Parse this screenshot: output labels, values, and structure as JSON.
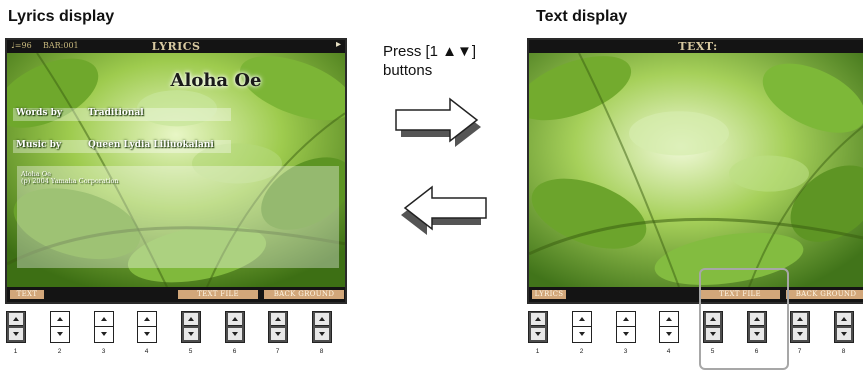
{
  "left_panel": {
    "heading": "Lyrics display",
    "screen": {
      "tempo": "♩=96",
      "bar": "BAR:001",
      "title": "LYRICS",
      "arrow_glyph": "▸",
      "song_title": "Aloha Oe",
      "words_label": "Words by",
      "words_value": "Traditional",
      "music_label": "Music by",
      "music_value": "Queen Lydia Liliuokalani",
      "copyright_line1": "Aloha Oe",
      "copyright_line2": "(p) 2004 Yamaha Corporation",
      "softkeys": {
        "text": "TEXT",
        "text_file": "TEXT FILE",
        "background": "BACK GROUND"
      }
    }
  },
  "right_panel": {
    "heading": "Text display",
    "screen": {
      "title": "TEXT:",
      "softkeys": {
        "lyrics": "LYRICS",
        "text_file": "TEXT FILE",
        "background": "BACK GROUND"
      }
    }
  },
  "hardware_buttons": {
    "numbers": [
      "1",
      "2",
      "3",
      "4",
      "5",
      "6",
      "7",
      "8"
    ]
  },
  "instruction": {
    "line1": "Press [1 ▲▼]",
    "line2": "buttons"
  },
  "colors": {
    "screen_bar": "#141414",
    "softkey": "#d2a77a",
    "leaf_green": "#5e9a20",
    "highlight_frame": "#a7a7a7"
  }
}
